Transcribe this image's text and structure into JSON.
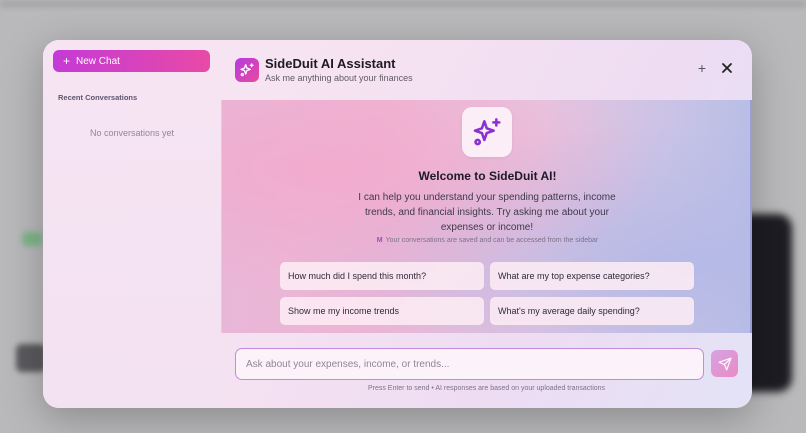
{
  "sidebar": {
    "new_chat_label": "New Chat",
    "recent_label": "Recent Conversations",
    "empty_text": "No conversations yet"
  },
  "header": {
    "title": "SideDuit AI Assistant",
    "subtitle": "Ask me anything about your finances",
    "add_icon": "plus-icon",
    "close_icon": "close-icon"
  },
  "welcome": {
    "title": "Welcome to SideDuit AI!",
    "intro": "I can help you understand your spending patterns, income trends, and financial insights. Try asking me about your expenses or income!",
    "saved_note_prefix": "M",
    "saved_note": "Your conversations are saved and can be accessed from the sidebar"
  },
  "suggestions": [
    "How much did I spend this month?",
    "What are my top expense categories?",
    "Show me my income trends",
    "What's my average daily spending?"
  ],
  "input": {
    "placeholder": "Ask about your expenses, income, or trends...",
    "value": "",
    "footer": "Press Enter to send • AI responses are based on your uploaded transactions"
  },
  "colors": {
    "accent_start": "#c43ad6",
    "accent_end": "#e84aa6",
    "icon_purple": "#8a2fd0"
  }
}
